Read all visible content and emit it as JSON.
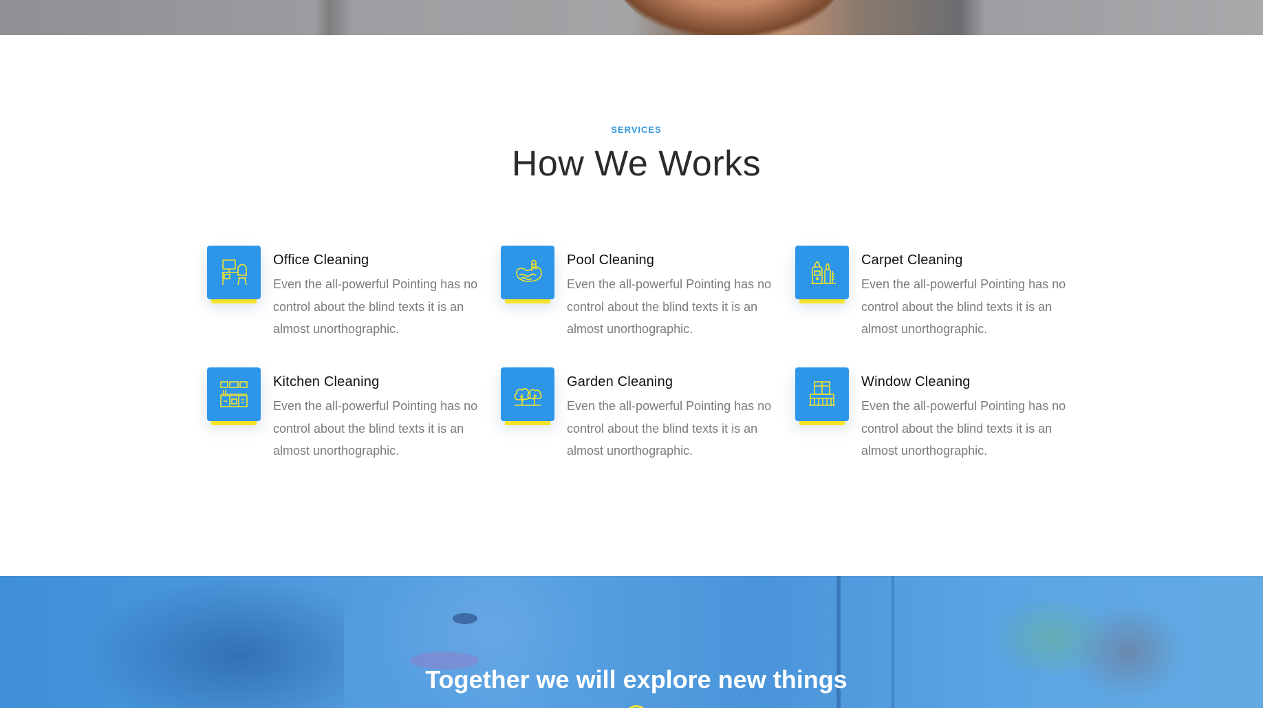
{
  "services": {
    "eyebrow": "SERVICES",
    "heading": "How We Works",
    "items": [
      {
        "title": "Office Cleaning",
        "desc": "Even the all-powerful Pointing has no control about the blind texts it is an almost unorthographic.",
        "icon": "office-desk-icon"
      },
      {
        "title": "Pool Cleaning",
        "desc": "Even the all-powerful Pointing has no control about the blind texts it is an almost unorthographic.",
        "icon": "pool-icon"
      },
      {
        "title": "Carpet Cleaning",
        "desc": "Even the all-powerful Pointing has no control about the blind texts it is an almost unorthographic.",
        "icon": "carpet-vacuum-icon"
      },
      {
        "title": "Kitchen Cleaning",
        "desc": "Even the all-powerful Pointing has no control about the blind texts it is an almost unorthographic.",
        "icon": "kitchen-icon"
      },
      {
        "title": "Garden Cleaning",
        "desc": "Even the all-powerful Pointing has no control about the blind texts it is an almost unorthographic.",
        "icon": "garden-trees-icon"
      },
      {
        "title": "Window Cleaning",
        "desc": "Even the all-powerful Pointing has no control about the blind texts it is an almost unorthographic.",
        "icon": "window-balcony-icon"
      }
    ]
  },
  "cta": {
    "title": "Together we will explore new things"
  },
  "colors": {
    "accent_blue": "#2e96e8",
    "accent_yellow": "#f5e32a",
    "eyebrow_blue": "#2f96e3",
    "heading_text": "#2b2b2b",
    "body_text": "#7b7b7b",
    "cta_overlay": "#4c98db"
  }
}
